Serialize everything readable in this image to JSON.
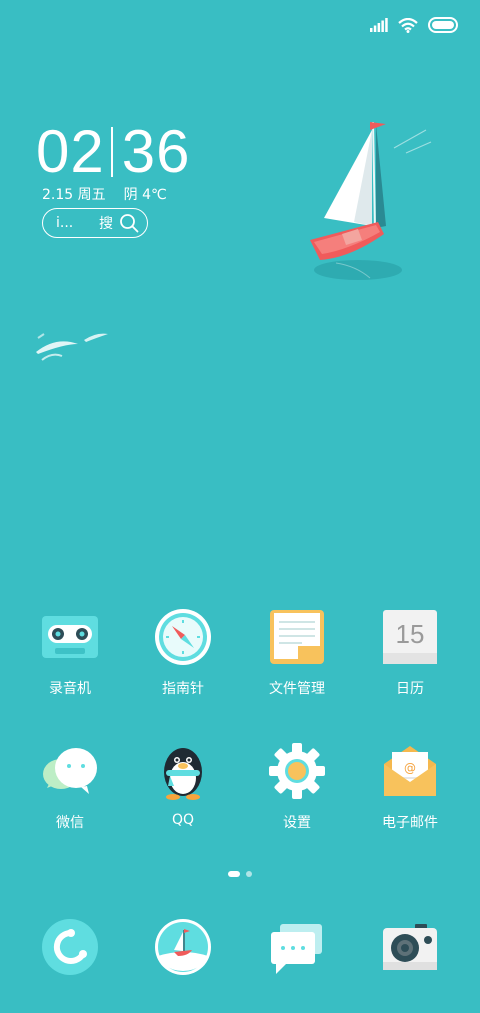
{
  "status_bar": {
    "signal_icon": "signal-bars-icon",
    "wifi_icon": "wifi-icon",
    "battery_icon": "battery-icon"
  },
  "clock": {
    "hours": "02",
    "minutes": "36"
  },
  "date_weather": {
    "date": "2.15 周五",
    "weather": "阴 4℃"
  },
  "search": {
    "hint": "i...",
    "action": "搜",
    "icon": "search-icon"
  },
  "apps": [
    {
      "label": "录音机",
      "icon": "cassette-recorder-icon"
    },
    {
      "label": "指南针",
      "icon": "compass-icon"
    },
    {
      "label": "文件管理",
      "icon": "file-manager-icon"
    },
    {
      "label": "日历",
      "icon": "calendar-icon",
      "day": "15"
    },
    {
      "label": "微信",
      "icon": "wechat-icon"
    },
    {
      "label": "QQ",
      "icon": "qq-penguin-icon"
    },
    {
      "label": "设置",
      "icon": "gear-icon"
    },
    {
      "label": "电子邮件",
      "icon": "email-envelope-icon"
    }
  ],
  "page_indicator": {
    "pages": 2,
    "current": 1
  },
  "dock": [
    {
      "icon": "phone-icon"
    },
    {
      "icon": "browser-sailboat-icon"
    },
    {
      "icon": "messages-icon"
    },
    {
      "icon": "camera-icon"
    }
  ],
  "colors": {
    "background": "#39bec3",
    "accent_red": "#f05b5b",
    "icon_cyan": "#5fdde0"
  }
}
